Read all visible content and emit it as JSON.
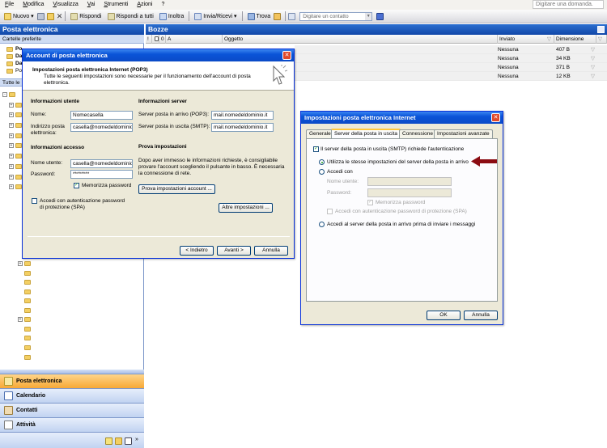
{
  "menu": [
    "File",
    "Modifica",
    "Visualizza",
    "Vai",
    "Strumenti",
    "Azioni",
    "?"
  ],
  "help_placeholder": "Digitare una domanda.",
  "toolbar": {
    "new": "Nuovo",
    "reply": "Rispondi",
    "reply_all": "Rispondi a tutti",
    "forward": "Inoltra",
    "send_receive": "Invia/Ricevi",
    "find": "Trova",
    "contact_placeholder": "Digitare un contatto"
  },
  "left": {
    "header": "Posta elettronica",
    "favorites": "Cartelle preferite",
    "fav_items": [
      "Po",
      "Da",
      "Da",
      "Po"
    ],
    "all_label": "Tutte le",
    "nav": [
      "Posta elettronica",
      "Calendario",
      "Contatti",
      "Attività"
    ]
  },
  "right": {
    "header": "Bozze",
    "columns": {
      "subject": "Oggetto",
      "sent": "Inviato",
      "size": "Dimensione",
      "a": "A"
    },
    "rows": [
      {
        "sent": "Nessuna",
        "size": "407 B"
      },
      {
        "sent": "Nessuna",
        "size": "34 KB"
      },
      {
        "sent": "Nessuna",
        "size": "371 B"
      },
      {
        "sent": "Nessuna",
        "size": "12 KB"
      }
    ]
  },
  "account": {
    "title": "Account di posta elettronica",
    "heading": "Impostazioni posta elettronica Internet (POP3)",
    "sub": "Tutte le seguenti impostazioni sono necessarie per il funzionamento dell'account di posta elettronica.",
    "user_info": "Informazioni utente",
    "name_label": "Nome:",
    "name_value": "Nomecasella",
    "email_label": "Indirizzo posta elettronica:",
    "email_value": "casella@nomedeldominio.it",
    "server_info": "Informazioni server",
    "incoming_label": "Server posta in arrivo (POP3):",
    "incoming_value": "mail.nomedeldominio.it",
    "outgoing_label": "Server posta in uscita (SMTP):",
    "outgoing_value": "mail.nomedeldominio.it",
    "access_info": "Informazioni accesso",
    "username_label": "Nome utente:",
    "username_value": "casella@nomedeldominio.it",
    "password_label": "Password:",
    "password_value": "********",
    "remember": "Memorizza password",
    "spa": "Accedi con autenticazione password di protezione (SPA)",
    "test_heading": "Prova impostazioni",
    "test_text": "Dopo aver immesso le informazioni richieste, è consigliabile provare l'account scegliendo il pulsante in basso. È necessaria la connessione di rete.",
    "test_button": "Prova impostazioni account ...",
    "more_button": "Altre impostazioni ...",
    "back": "< Indietro",
    "next": "Avanti >",
    "cancel": "Annulla"
  },
  "internet": {
    "title": "Impostazioni posta elettronica Internet",
    "tabs": [
      "Generale",
      "Server della posta in uscita",
      "Connessione",
      "Impostazioni avanzate"
    ],
    "smtp_auth": "Il server della posta in uscita (SMTP) richiede l'autenticazione",
    "same_settings": "Utilizza le stesse impostazioni del server della posta in arrivo",
    "login_with": "Accedi con",
    "username_label": "Nome utente:",
    "password_label": "Password:",
    "remember": "Memorizza password",
    "spa": "Accedi con autenticazione password di protezione (SPA)",
    "login_before": "Accedi al server della posta in arrivo prima di inviare i messaggi",
    "ok": "OK",
    "cancel": "Annulla"
  },
  "colors": {
    "titlebar": "#0a54d8",
    "pane_header": "#1a5cc4",
    "arrow": "#8b0c12"
  }
}
